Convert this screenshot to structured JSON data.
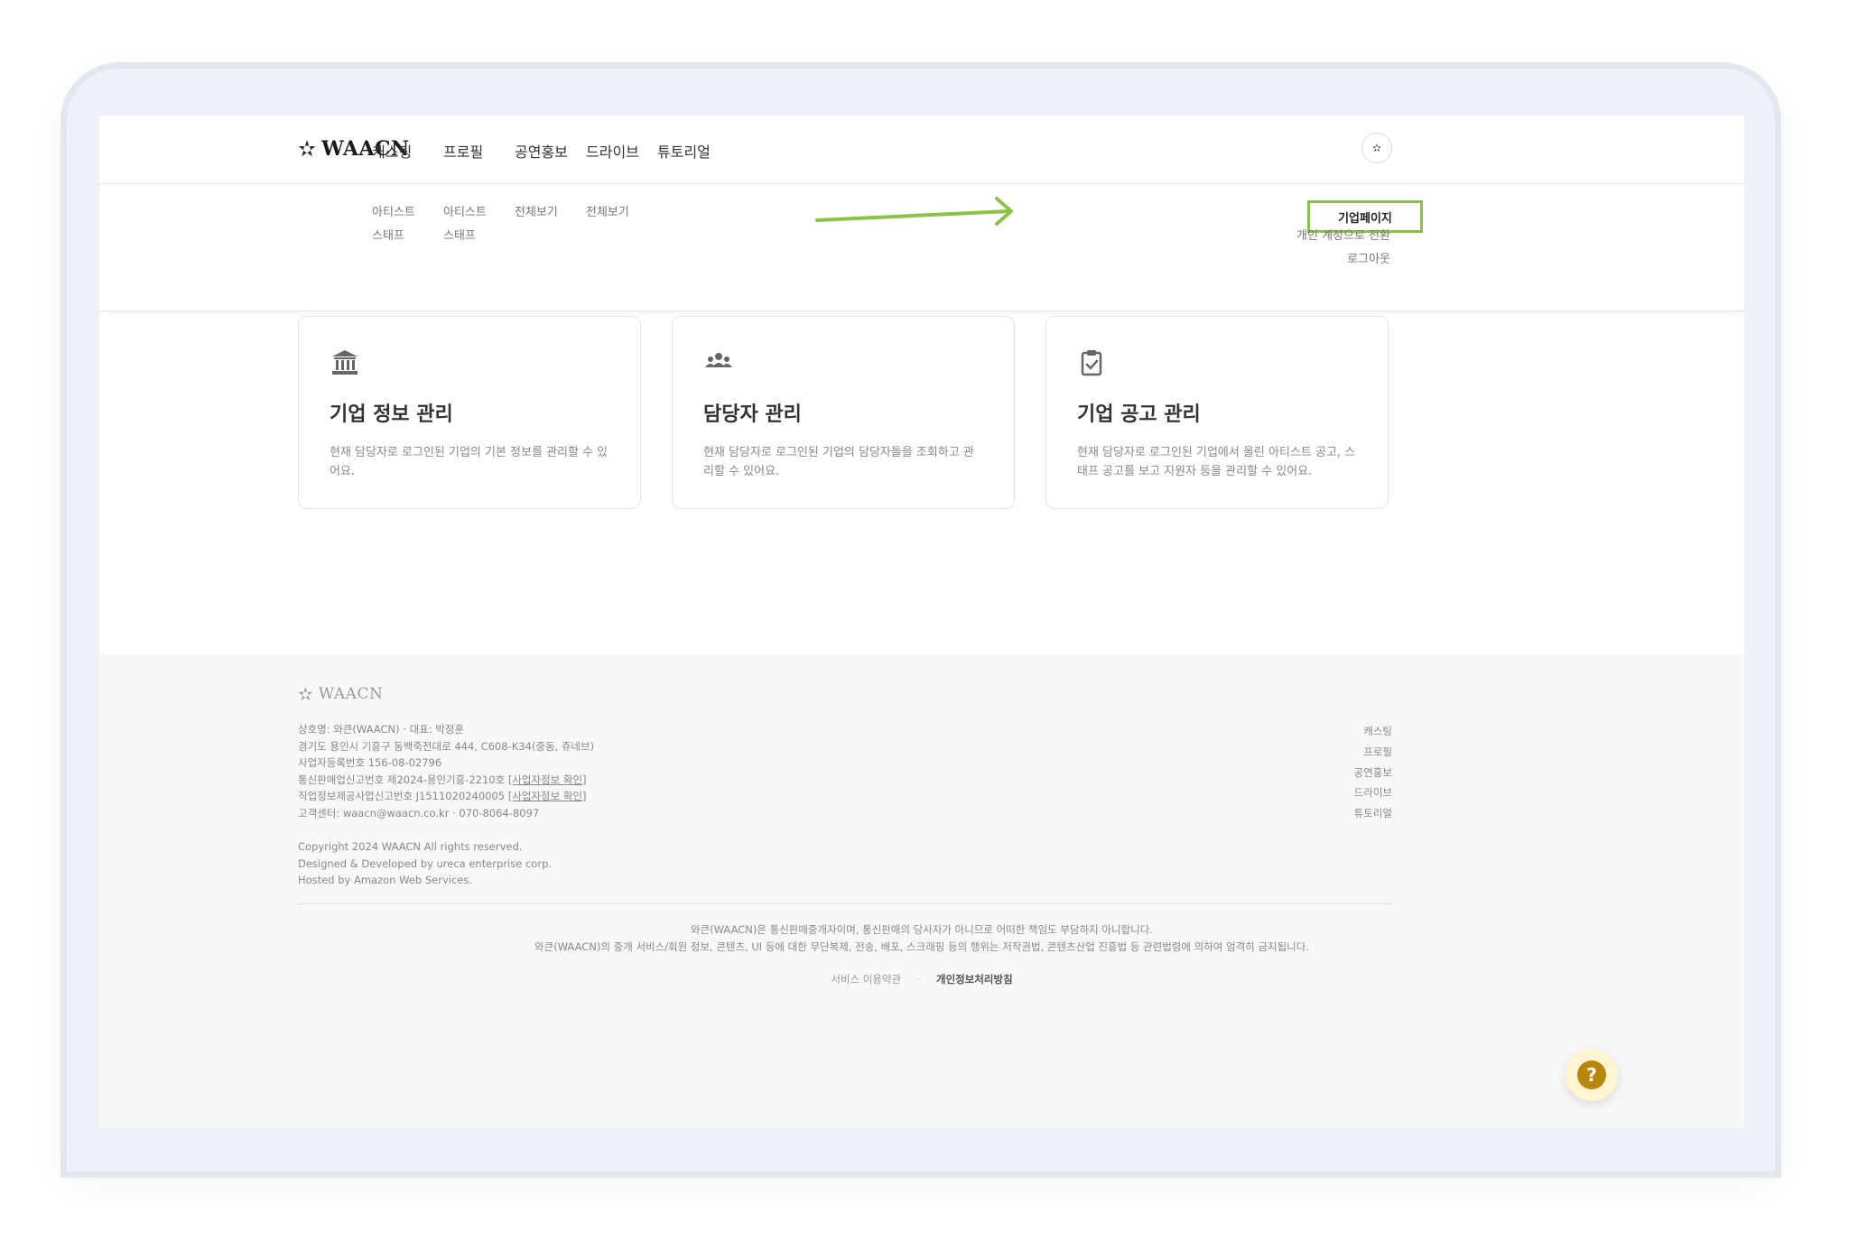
{
  "brand": {
    "name": "WAACN",
    "star": "✫"
  },
  "nav": [
    {
      "label": "캐스팅",
      "sub": [
        "아티스트",
        "스태프"
      ]
    },
    {
      "label": "프로필",
      "sub": [
        "아티스트",
        "스태프"
      ]
    },
    {
      "label": "공연홍보",
      "sub": [
        "전체보기"
      ]
    },
    {
      "label": "드라이브",
      "sub": [
        "전체보기"
      ]
    },
    {
      "label": "튜토리얼",
      "sub": []
    }
  ],
  "account_menu": {
    "highlighted": "기업페이지",
    "switch": "개인 계정으로 전환",
    "logout": "로그아웃"
  },
  "cards": [
    {
      "icon": "bank-icon",
      "title": "기업 정보 관리",
      "desc": "현재 담당자로 로그인된 기업의 기본 정보를 관리할 수 있어요."
    },
    {
      "icon": "users-icon",
      "title": "담당자 관리",
      "desc": "현재 담당자로 로그인된 기업의 담당자들을 조회하고 관리할 수 있어요."
    },
    {
      "icon": "clipboard-check-icon",
      "title": "기업 공고 관리",
      "desc": "현재 담당자로 로그인된 기업에서 올린 아티스트 공고, 스태프 공고를 보고 지원자 등을 관리할 수 있어요."
    }
  ],
  "footer": {
    "company": "상호명: 와큰(WAACN) · 대표: 박정훈",
    "address": "경기도 용인시 기흥구 동백죽전대로 444, C608-K34(중동, 쥬네브)",
    "bizno": "사업자등록번호 156-08-02796",
    "ecommerce": "통신판매업신고번호 제2024-용인기흥-2210호",
    "ecommerce_link": "[사업자정보 확인]",
    "jobinfo": "직업정보제공사업신고번호 J1511020240005",
    "jobinfo_link": "[사업자정보 확인]",
    "contact": "고객센터: waacn@waacn.co.kr · 070-8064-8097",
    "copyright": "Copyright 2024 WAACN All rights reserved.",
    "designed": "Designed & Developed by ureca enterprise corp.",
    "hosted": "Hosted by Amazon Web Services.",
    "links": [
      "캐스팅",
      "프로필",
      "공연홍보",
      "드라이브",
      "튜토리얼"
    ],
    "notice1": "와큰(WAACN)은 통신판매중개자이며, 통신판매의 당사자가 아니므로 어떠한 책임도 부담하지 아니합니다.",
    "notice2": "와큰(WAACN)의 중개 서비스/회원 정보, 콘텐츠, UI 등에 대한 무단복제, 전송, 배포, 스크래핑 등의 행위는 저작권법, 콘텐츠산업 진흥법 등 관련법령에 의하여 엄격히 금지됩니다.",
    "terms": "서비스 이용약관",
    "privacy": "개인정보처리방침",
    "separator": "·"
  },
  "help": {
    "label": "?"
  },
  "colors": {
    "highlight": "#8bc34a",
    "help_bg": "#fff5d1",
    "help_fg": "#b8860b"
  }
}
